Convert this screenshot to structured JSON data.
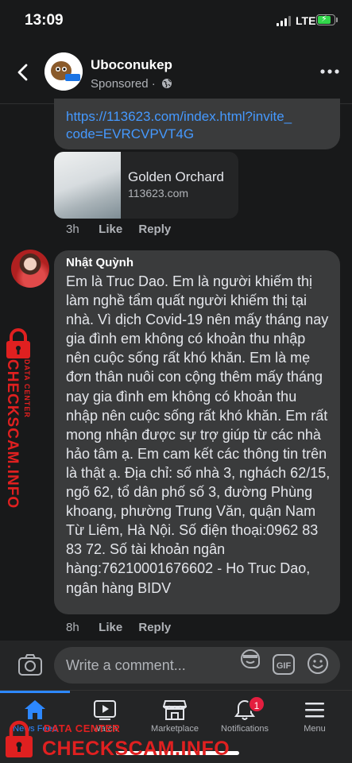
{
  "status_bar": {
    "time": "13:09",
    "network": "LTE"
  },
  "post": {
    "page_name": "Uboconukep",
    "sponsored_label": "Sponsored · "
  },
  "ad_comment": {
    "link": "https://113623.com/index.html?invite_code=EVRCVPVT4G",
    "preview_title": "Golden Orchard",
    "preview_domain": "113623.com",
    "time": "3h",
    "like_label": "Like",
    "reply_label": "Reply"
  },
  "comment": {
    "author": "Nhật Quỳnh",
    "text": "Em là Truc Dao. Em là người khiếm thị làm nghề tẩm quất người khiếm thị tại nhà. Vì dịch Covid-19 nên mấy tháng nay gia đình em không có khoản thu nhập nên cuộc sống rất khó khăn. Em là mẹ đơn thân nuôi con cộng thêm mấy tháng nay gia đình em không có khoản thu nhập nên cuộc sống rất khó khăn. Em rất mong nhận được sự trợ giúp từ các nhà hảo tâm ạ. Em cam kết các thông tin trên là thật ạ. Địa chỉ: số nhà 3, nghách 62/15, ngõ 62, tổ dân phố số 3, đường Phùng khoang, phường Trung Văn, quận Nam Từ Liêm, Hà Nội. Số điện thoại:0962 83 83 72. Số tài khoản ngân hàng:76210001676602 - Ho Truc Dao, ngân hàng BIDV",
    "time": "8h",
    "like_label": "Like",
    "reply_label": "Reply"
  },
  "composer": {
    "placeholder": "Write a comment..."
  },
  "nav": {
    "items": [
      {
        "label": "News Feed",
        "icon": "home-icon",
        "active": true
      },
      {
        "label": "Watch",
        "icon": "watch-icon"
      },
      {
        "label": "Marketplace",
        "icon": "marketplace-icon"
      },
      {
        "label": "Notifications",
        "icon": "bell-icon",
        "badge": "1"
      },
      {
        "label": "Menu",
        "icon": "menu-icon"
      }
    ]
  },
  "watermark": {
    "sub": "DATA CENTER",
    "title": "CHECKSCAM.INFO"
  },
  "colors": {
    "background": "#18191a",
    "bubble": "#3a3b3c",
    "link": "#4599ff",
    "accent": "#2d88ff",
    "watermark": "#e02020",
    "badge": "#e41e3f"
  }
}
